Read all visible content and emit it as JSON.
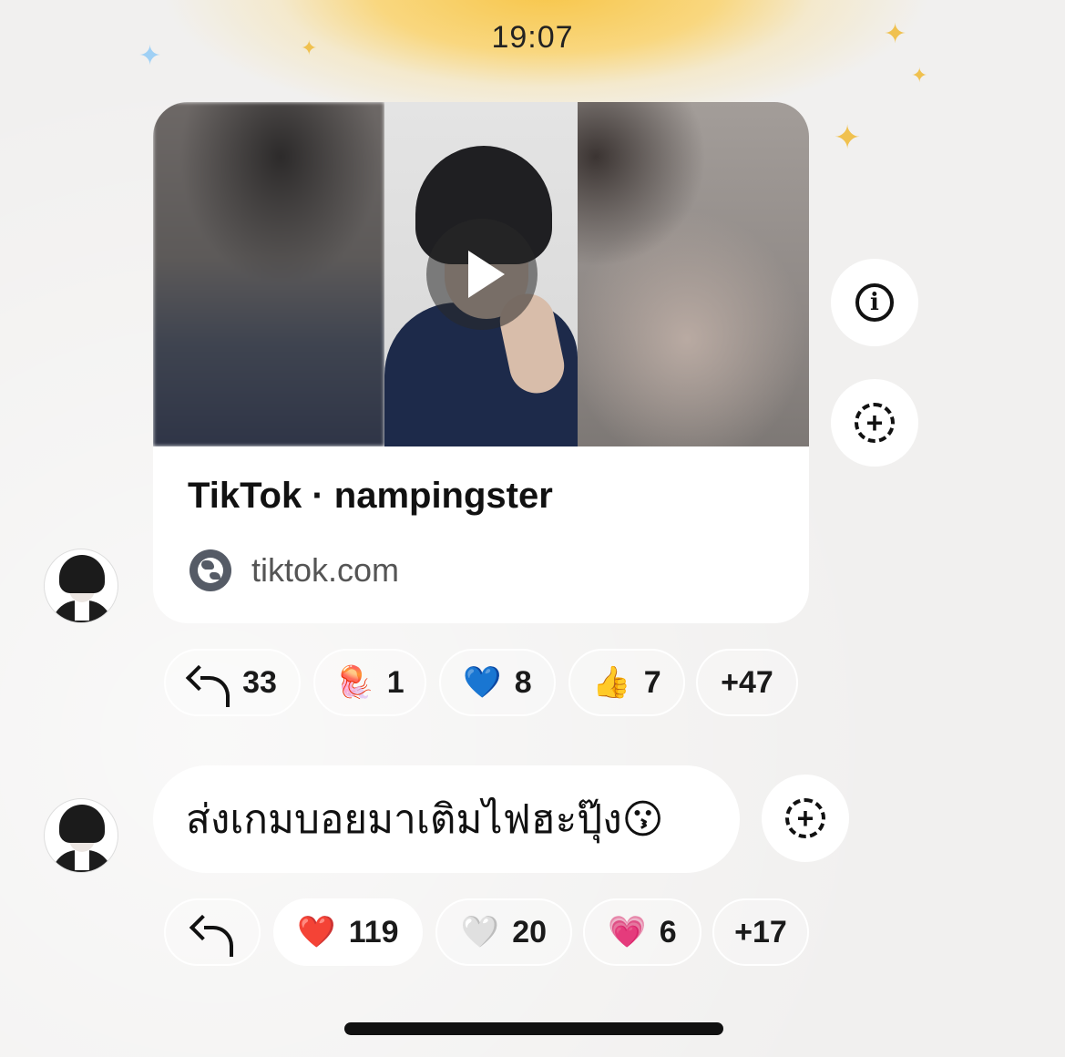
{
  "status_bar": {
    "time": "19:07"
  },
  "messages": [
    {
      "type": "link_card",
      "card": {
        "title": "TikTok · nampingster",
        "source": "tiktok.com",
        "source_icon": "globe-icon"
      },
      "reactions": [
        {
          "icon": "reply-icon",
          "count": "33"
        },
        {
          "icon": "jellyfish-emoji",
          "emoji": "🪼",
          "count": "1"
        },
        {
          "icon": "blue-heart-emoji",
          "emoji": "💙",
          "count": "8"
        },
        {
          "icon": "thumbs-up-emoji",
          "emoji": "👍",
          "count": "7"
        },
        {
          "label": "+47"
        }
      ]
    },
    {
      "type": "text",
      "text": "ส่งเกมบอยมาเติมไฟฮะปุ๊ง😗",
      "reactions": [
        {
          "icon": "reply-icon",
          "count": ""
        },
        {
          "icon": "red-heart-emoji",
          "emoji": "❤️",
          "count": "119"
        },
        {
          "icon": "white-heart-emoji",
          "emoji": "🤍",
          "count": "20"
        },
        {
          "icon": "pink-heart-emoji",
          "emoji": "💗",
          "count": "6"
        },
        {
          "label": "+17"
        }
      ]
    }
  ],
  "colors": {
    "background": "#f1f0ef",
    "bubble": "#ffffff",
    "accent_glow": "#f7c64a"
  }
}
